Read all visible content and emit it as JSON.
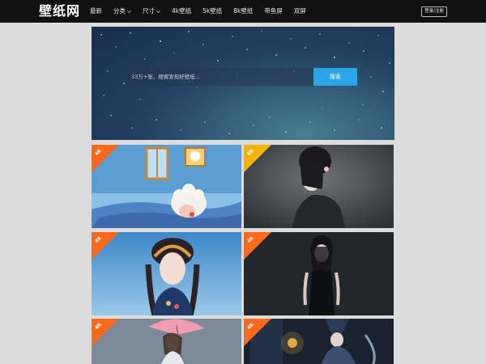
{
  "header": {
    "logo": "壁纸网",
    "nav": [
      {
        "label": "最新",
        "dropdown": false
      },
      {
        "label": "分类",
        "dropdown": true
      },
      {
        "label": "尺寸",
        "dropdown": true
      },
      {
        "label": "4k壁纸",
        "dropdown": false
      },
      {
        "label": "5k壁纸",
        "dropdown": false
      },
      {
        "label": "8k壁纸",
        "dropdown": false
      },
      {
        "label": "带鱼屏",
        "dropdown": false
      },
      {
        "label": "双屏",
        "dropdown": false
      }
    ],
    "login": "登录/注册"
  },
  "search": {
    "placeholder": "33万+张，搜索发现好壁纸...",
    "button": "搜索"
  },
  "wallpapers": [
    {
      "badge": "4K",
      "badge_color": "#ff6a1a",
      "subject": "cartoon-sheep-sleeping"
    },
    {
      "badge": "8K",
      "badge_color": "#f5b400",
      "subject": "girl-portrait-dark"
    },
    {
      "badge": "4K",
      "badge_color": "#ff6a1a",
      "subject": "girl-headdress-blue"
    },
    {
      "badge": "4K",
      "badge_color": "#ff6a1a",
      "subject": "woman-black-dress"
    },
    {
      "badge": "4K",
      "badge_color": "#ff6a1a",
      "subject": "girl-umbrella"
    },
    {
      "badge": "4K",
      "badge_color": "#ff6a1a",
      "subject": "fantasy-witch"
    }
  ],
  "colors": {
    "topbar": "#111111",
    "search_button": "#2ba4e6",
    "badge_4k": "#ff6a1a",
    "badge_8k": "#f5b400"
  }
}
